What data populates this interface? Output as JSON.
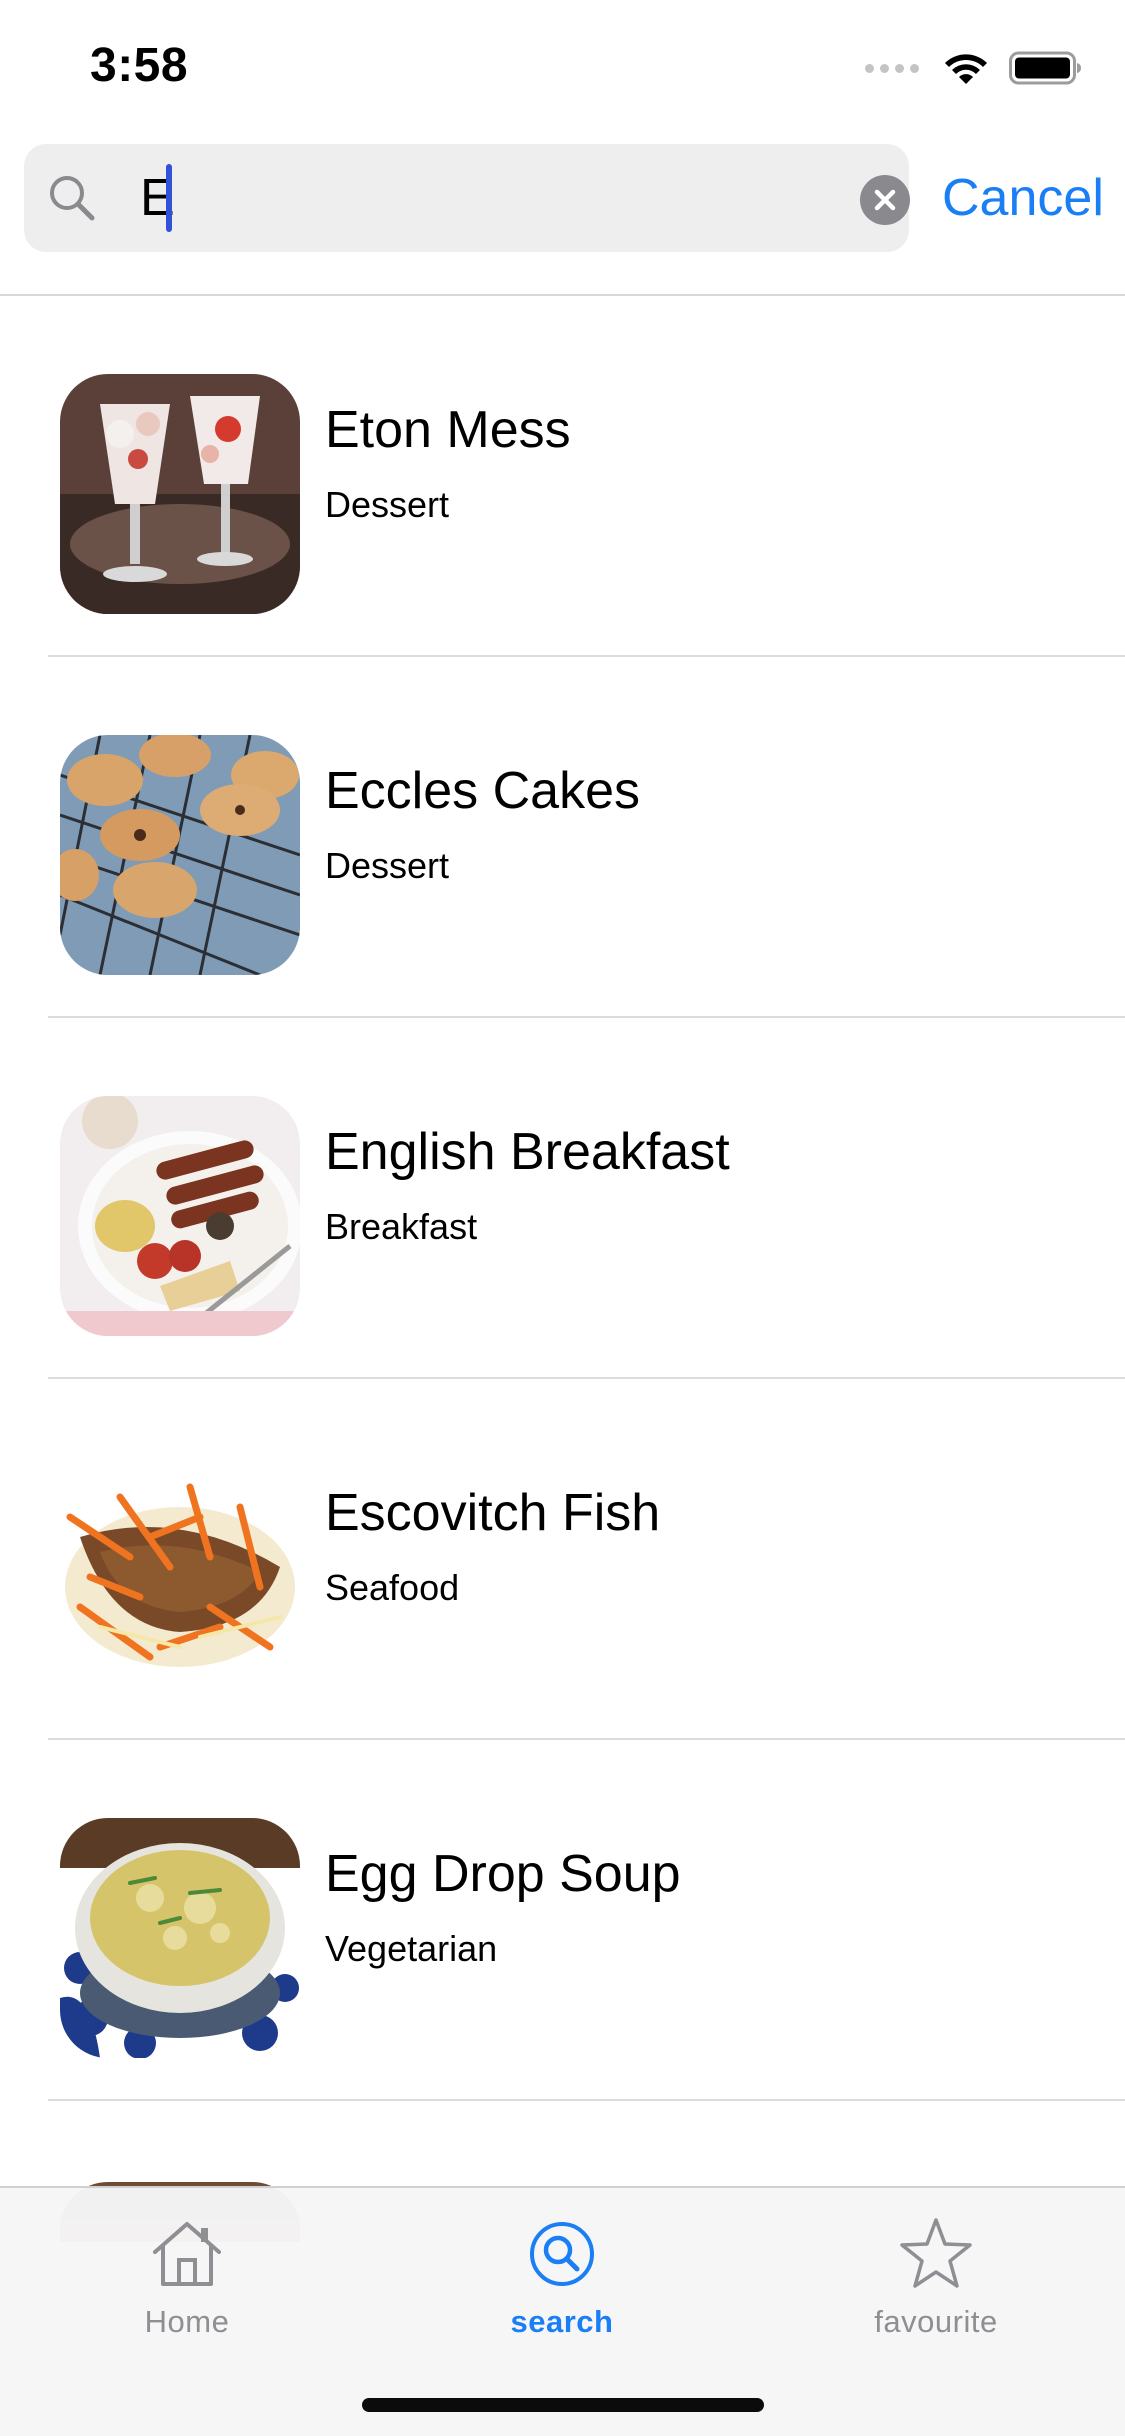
{
  "status_bar": {
    "time": "3:58"
  },
  "search": {
    "query": "E",
    "cancel_label": "Cancel"
  },
  "results": [
    {
      "title": "Eton Mess",
      "category": "Dessert",
      "thumb_icon": "eton-mess-photo"
    },
    {
      "title": "Eccles Cakes",
      "category": "Dessert",
      "thumb_icon": "eccles-cakes-photo"
    },
    {
      "title": "English Breakfast",
      "category": "Breakfast",
      "thumb_icon": "english-breakfast-photo"
    },
    {
      "title": "Escovitch Fish",
      "category": "Seafood",
      "thumb_icon": "escovitch-fish-photo"
    },
    {
      "title": "Egg Drop Soup",
      "category": "Vegetarian",
      "thumb_icon": "egg-drop-soup-photo"
    }
  ],
  "tab_bar": {
    "tabs": [
      {
        "label": "Home",
        "icon": "house-icon",
        "active": false
      },
      {
        "label": "search",
        "icon": "search-icon",
        "active": true
      },
      {
        "label": "favourite",
        "icon": "star-icon",
        "active": false
      }
    ]
  },
  "colors": {
    "accent": "#1a7ef5",
    "inactive": "#8e8e93",
    "search_field_bg": "#eeeeef",
    "caret": "#2f52d8"
  }
}
